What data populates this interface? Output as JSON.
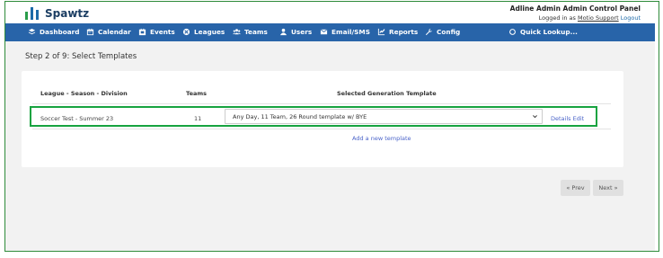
{
  "header": {
    "brand": "Spawtz",
    "panel_title": "Adline Admin Admin Control Panel",
    "logged_in_prefix": "Logged in as",
    "logged_in_user": "Motio Support",
    "logout_label": "Logout"
  },
  "nav": {
    "items": [
      {
        "label": "Dashboard",
        "icon": "dashboard-icon"
      },
      {
        "label": "Calendar",
        "icon": "calendar-icon"
      },
      {
        "label": "Events",
        "icon": "events-icon"
      },
      {
        "label": "Leagues",
        "icon": "leagues-icon"
      },
      {
        "label": "Teams",
        "icon": "teams-icon"
      },
      {
        "label": "Users",
        "icon": "users-icon"
      },
      {
        "label": "Email/SMS",
        "icon": "email-icon"
      },
      {
        "label": "Reports",
        "icon": "reports-icon"
      },
      {
        "label": "Config",
        "icon": "wrench-icon"
      }
    ],
    "quick_lookup_label": "Quick Lookup..."
  },
  "page": {
    "step_title": "Step 2 of 9: Select Templates"
  },
  "table": {
    "headers": {
      "league": "League - Season - Division",
      "teams": "Teams",
      "template": "Selected Generation Template"
    },
    "rows": [
      {
        "league": "Soccer Test - Summer 23",
        "teams": "11",
        "template": "Any Day, 11 Team, 26 Round template w/ BYE",
        "details_label": "Details",
        "edit_label": "Edit"
      }
    ],
    "add_template_label": "Add a new template"
  },
  "pager": {
    "prev_label": "« Prev",
    "next_label": "Next »"
  },
  "colors": {
    "nav_bg": "#2864a9",
    "highlight": "#17a340",
    "link": "#4a63c9"
  }
}
